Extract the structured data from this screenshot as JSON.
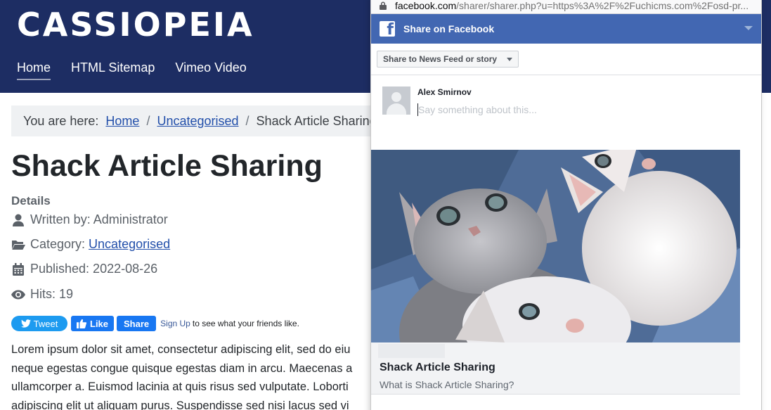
{
  "site": {
    "brand": "CASSIOPEIA",
    "nav": [
      "Home",
      "HTML Sitemap",
      "Vimeo Video"
    ]
  },
  "breadcrumb": {
    "prefix": "You are here:",
    "home": "Home",
    "category": "Uncategorised",
    "current": "Shack Article Sharing",
    "separator": "/"
  },
  "article": {
    "title": "Shack Article Sharing",
    "details_heading": "Details",
    "written_by": "Written by: Administrator",
    "category_label": "Category:",
    "category_link": "Uncategorised",
    "published": "Published: 2022-08-26",
    "hits": "Hits: 19",
    "body_lines": [
      "Lorem ipsum dolor sit amet, consectetur adipiscing elit, sed do eiu",
      "neque egestas congue quisque egestas diam in arcu. Maecenas a",
      "ullamcorper a. Euismod lacinia at quis risus sed vulputate. Loborti",
      "adipiscing elit ut aliquam purus. Suspendisse sed nisi lacus sed vi"
    ]
  },
  "social": {
    "tweet": "Tweet",
    "like": "Like",
    "share": "Share",
    "signup": "Sign Up",
    "signup_rest": "to see what your friends like."
  },
  "popup": {
    "url_host": "facebook.com",
    "url_path": "/sharer/sharer.php?u=https%3A%2F%2Fuchicms.com%2Fosd-pr...",
    "header_title": "Share on Facebook",
    "share_target": "Share to News Feed or story",
    "user_name": "Alex Smirnov",
    "composer_placeholder": "Say something about this...",
    "preview_title": "Shack Article Sharing",
    "preview_description": "What is Shack Article Sharing?"
  },
  "colors": {
    "header_bg": "#1d2d63",
    "link": "#224faa",
    "facebook_blue": "#4267b2",
    "twitter_blue": "#1d9bf0"
  }
}
